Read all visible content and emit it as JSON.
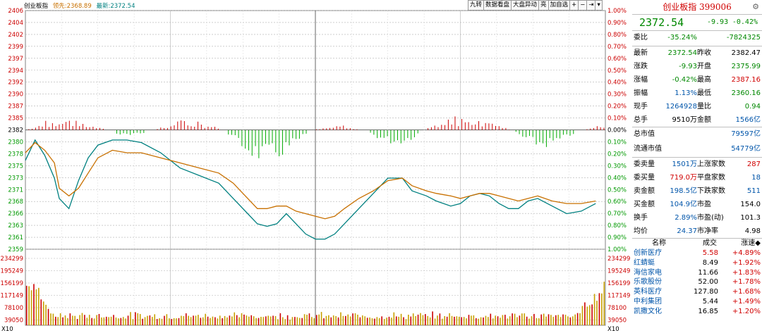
{
  "header": {
    "name": "创业板指",
    "ref_label": "领先:",
    "ref_value": "2368.89",
    "last_label": "最新:",
    "last_value": "2372.54"
  },
  "toolbar": [
    "九转",
    "数据看盘",
    "大盘异动",
    "亮",
    "加自选",
    "+",
    "−",
    "⇥",
    "▾"
  ],
  "chart_data": {
    "type": "line",
    "price_axis": {
      "ticks": [
        "2406",
        "2404",
        "2402",
        "2399",
        "2397",
        "2394",
        "2392",
        "2390",
        "2387",
        "2385",
        "2382",
        "2380",
        "2378",
        "2375",
        "2373",
        "2371",
        "2368",
        "2366",
        "2363",
        "2361",
        "2359"
      ],
      "ylim": [
        2359,
        2406
      ],
      "prev_close": 2382.47
    },
    "pct_axis": {
      "ticks": [
        "1.00%",
        "0.90%",
        "0.80%",
        "0.70%",
        "0.60%",
        "0.50%",
        "0.40%",
        "0.30%",
        "0.20%",
        "0.10%",
        "0.00%",
        "0.10%",
        "0.20%",
        "0.30%",
        "0.40%",
        "0.50%",
        "0.60%",
        "0.70%",
        "0.80%",
        "0.90%",
        "1.00%"
      ]
    },
    "volume_axis": {
      "ticks": [
        "234299",
        "195249",
        "156199",
        "117149",
        "78100",
        "39050"
      ],
      "ylim": [
        0,
        234299
      ],
      "unit_label": "X10"
    },
    "series": [
      {
        "x": [
          0,
          4,
          8,
          12,
          14,
          18,
          22,
          26,
          30,
          36,
          42,
          48,
          56,
          64,
          72,
          80,
          86,
          92,
          96,
          100,
          104,
          108,
          112,
          116,
          120,
          124,
          128,
          132,
          138,
          144,
          150,
          156,
          160,
          166,
          170,
          176,
          180,
          184,
          188,
          192,
          196,
          200,
          204,
          208,
          212,
          218,
          224,
          230,
          236
        ],
        "values": [
          2376.5,
          2380.5,
          2377.5,
          2373,
          2369,
          2367,
          2372.5,
          2377,
          2379.5,
          2380.5,
          2380.5,
          2380,
          2378,
          2375,
          2373.5,
          2372,
          2369,
          2366,
          2364,
          2363.5,
          2364,
          2366,
          2364,
          2362,
          2361,
          2361,
          2362,
          2364,
          2367,
          2370,
          2373,
          2373,
          2370.5,
          2369.5,
          2368.5,
          2367.5,
          2368,
          2369.5,
          2370,
          2369.5,
          2368,
          2367,
          2367,
          2368.5,
          2369,
          2367.5,
          2366,
          2366.5,
          2368
        ]
      },
      {
        "x": [
          0,
          4,
          8,
          12,
          14,
          18,
          22,
          26,
          30,
          36,
          42,
          48,
          56,
          64,
          72,
          80,
          86,
          92,
          96,
          100,
          104,
          108,
          112,
          116,
          120,
          124,
          128,
          132,
          138,
          144,
          150,
          156,
          160,
          166,
          170,
          176,
          180,
          184,
          188,
          192,
          196,
          200,
          204,
          208,
          212,
          218,
          224,
          230,
          236
        ],
        "values": [
          2378,
          2380,
          2378.5,
          2376,
          2371,
          2369.5,
          2371,
          2374,
          2377,
          2378.5,
          2378,
          2378,
          2377,
          2376,
          2375,
          2374,
          2372,
          2369,
          2367,
          2367,
          2367.5,
          2367.5,
          2366.5,
          2366,
          2365.5,
          2365,
          2365.5,
          2367,
          2369,
          2370.5,
          2372.5,
          2373,
          2371.5,
          2370.5,
          2370,
          2369.5,
          2369,
          2369.5,
          2370,
          2370,
          2369.5,
          2369,
          2368.5,
          2369,
          2369.5,
          2368.5,
          2368,
          2368,
          2368.5
        ]
      }
    ]
  },
  "panel": {
    "title": "创业板指 399006",
    "price": "2372.54",
    "change": "-9.93",
    "change_pct": "-0.42%",
    "rows1": [
      {
        "l1": "委比",
        "v1": "-35.24%",
        "c1": "g",
        "l2": "",
        "v2": "-7824325",
        "c2": "g"
      }
    ],
    "rows2": [
      {
        "l1": "最新",
        "v1": "2372.54",
        "c1": "g",
        "l2": "昨收",
        "v2": "2382.47",
        "c2": "k"
      },
      {
        "l1": "涨跌",
        "v1": "-9.93",
        "c1": "g",
        "l2": "开盘",
        "v2": "2375.99",
        "c2": "g"
      },
      {
        "l1": "涨幅",
        "v1": "-0.42%",
        "c1": "g",
        "l2": "最高",
        "v2": "2387.16",
        "c2": "r"
      },
      {
        "l1": "振幅",
        "v1": "1.13%",
        "c1": "b",
        "l2": "最低",
        "v2": "2360.16",
        "c2": "g"
      },
      {
        "l1": "现手",
        "v1": "1264928",
        "c1": "b",
        "l2": "量比",
        "v2": "0.94",
        "c2": "g"
      },
      {
        "l1": "总手",
        "v1": "9510万",
        "c1": "k",
        "l2": "金额",
        "v2": "1566亿",
        "c2": "b"
      }
    ],
    "rows3": [
      {
        "l1": "总市值",
        "v1": "79597亿",
        "c1": "b"
      },
      {
        "l1": "流通市值",
        "v1": "54779亿",
        "c1": "b"
      }
    ],
    "rows4": [
      {
        "l1": "委卖量",
        "v1": "1501万",
        "c1": "b",
        "l2": "上涨家数",
        "v2": "287",
        "c2": "r"
      },
      {
        "l1": "委买量",
        "v1": "719.0万",
        "c1": "r",
        "l2": "平盘家数",
        "v2": "18",
        "c2": "b"
      },
      {
        "l1": "卖金额",
        "v1": "198.5亿",
        "c1": "b",
        "l2": "下跌家数",
        "v2": "511",
        "c2": "b"
      },
      {
        "l1": "买金额",
        "v1": "104.9亿",
        "c1": "b",
        "l2": "市盈",
        "v2": "154.0",
        "c2": "k"
      },
      {
        "l1": "换手",
        "v1": "2.89%",
        "c1": "b",
        "l2": "市盈(动)",
        "v2": "101.3",
        "c2": "k"
      },
      {
        "l1": "均价",
        "v1": "24.37",
        "c1": "b",
        "l2": "市净率",
        "v2": "4.98",
        "c2": "k"
      }
    ],
    "stocks_header": {
      "name": "名称",
      "amount": "成交",
      "speed": "涨速◆"
    },
    "stocks": [
      {
        "name": "创新医疗",
        "price": "5.58",
        "speed": "+4.89%"
      },
      {
        "name": "红蜻蜓",
        "price": "8.49",
        "speed": "+1.92%"
      },
      {
        "name": "海信家电",
        "price": "11.66",
        "speed": "+1.83%"
      },
      {
        "name": "乐歌股份",
        "price": "52.00",
        "speed": "+1.78%"
      },
      {
        "name": "英科医疗",
        "price": "127.80",
        "speed": "+1.68%"
      },
      {
        "name": "中利集团",
        "price": "5.44",
        "speed": "+1.49%"
      },
      {
        "name": "凯撒文化",
        "price": "16.85",
        "speed": "+1.20%"
      }
    ]
  },
  "colors": {
    "price_line": "#008080",
    "avg_line": "#c87000",
    "up": "#cc0000",
    "down": "#00aa00"
  }
}
